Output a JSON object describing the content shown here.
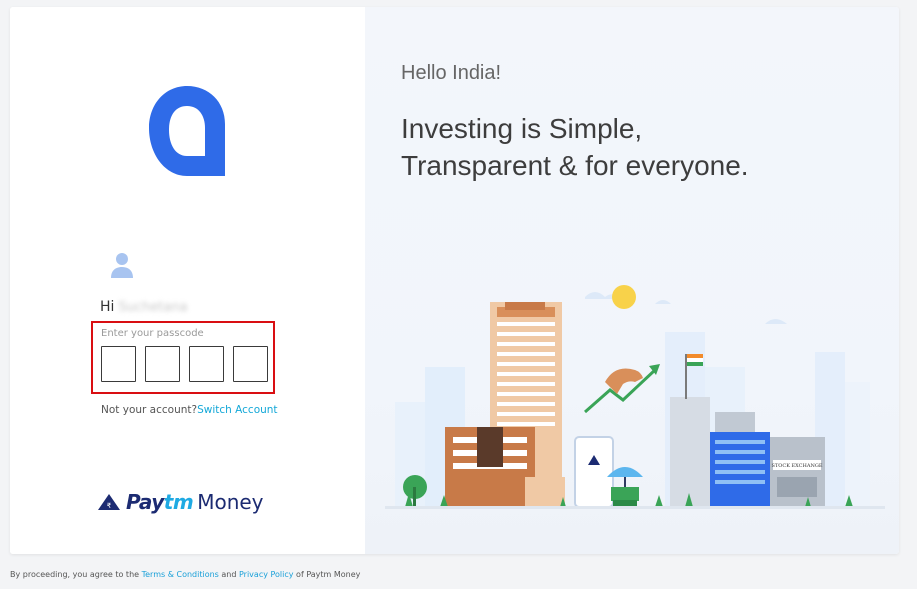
{
  "left_panel": {
    "greeting_prefix": "Hi",
    "user_name": "Suchetana",
    "passcode_label": "Enter your passcode",
    "pin_count": 4,
    "not_account_text": "Not your account?",
    "switch_account_label": "Switch Account",
    "brand": {
      "pay": "Pay",
      "tm": "tm",
      "money": "Money"
    }
  },
  "right_panel": {
    "hello": "Hello India!",
    "tagline_line1": "Investing is Simple,",
    "tagline_line2": "Transparent & for everyone.",
    "building_sign": "STOCK EXCHANGE"
  },
  "footer": {
    "prefix": "By proceeding, you agree to the ",
    "terms": "Terms & Conditions",
    "and": " and ",
    "privacy": "Privacy Policy",
    "suffix": " of Paytm Money"
  },
  "colors": {
    "accent_blue": "#2f6be8",
    "link_blue": "#14a8d8",
    "error_red": "#d90e12",
    "paytm_navy": "#1c2b72",
    "paytm_cyan": "#1faae3"
  },
  "icons": [
    "app-logo-icon",
    "user-icon",
    "paytm-money-logo-icon"
  ]
}
